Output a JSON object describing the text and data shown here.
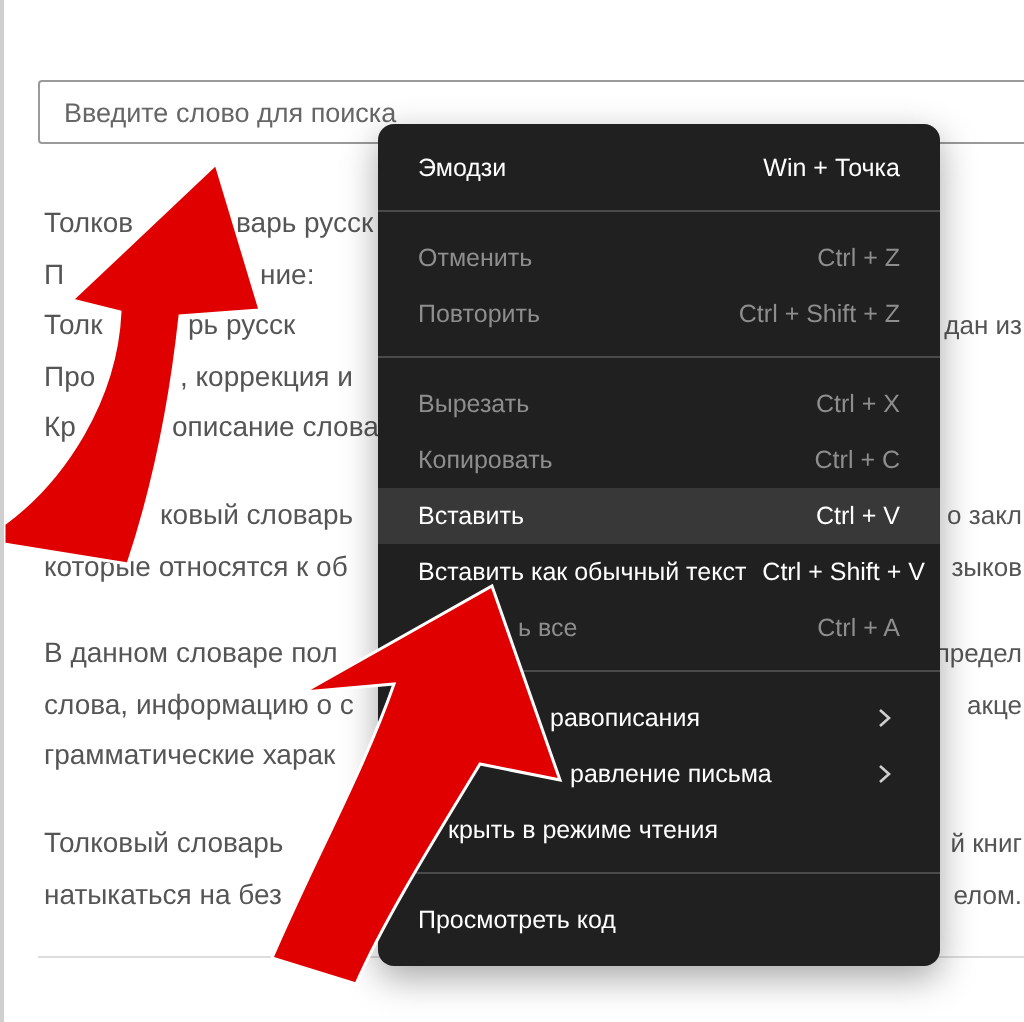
{
  "search": {
    "placeholder": "Введите слово для поиска"
  },
  "paragraphs": [
    {
      "lines": [
        {
          "parts": [
            "Толков",
            "варь русск"
          ]
        },
        {
          "parts": [
            "П",
            "ние:"
          ]
        },
        {
          "parts": [
            "Толк",
            "рь русск"
          ],
          "right": "дан из"
        },
        {
          "parts": [
            "Про",
            ", коррекция и"
          ]
        },
        {
          "parts": [
            "Кр",
            "описание слова"
          ]
        }
      ]
    },
    {
      "lines": [
        {
          "parts": [
            "ковый словарь"
          ],
          "right": "о закл"
        },
        {
          "parts": [
            "которые относятся к об"
          ],
          "right": "зыков"
        }
      ]
    },
    {
      "lines": [
        {
          "parts": [
            "В данном словаре пол"
          ],
          "right": "предел"
        },
        {
          "parts": [
            "слова, информацию о с"
          ],
          "right": "акце"
        },
        {
          "parts": [
            "грамматические харак"
          ]
        }
      ]
    },
    {
      "lines": [
        {
          "parts": [
            "Толковый словарь"
          ],
          "right": "й книг"
        },
        {
          "parts": [
            "натыкаться на без"
          ],
          "right": "елом."
        }
      ]
    }
  ],
  "context_menu": {
    "items": [
      {
        "kind": "item",
        "label": "Эмодзи",
        "shortcut": "Win + Точка",
        "disabled": false,
        "selected": false
      },
      {
        "kind": "divider"
      },
      {
        "kind": "item",
        "label": "Отменить",
        "shortcut": "Ctrl + Z",
        "disabled": true,
        "selected": false
      },
      {
        "kind": "item",
        "label": "Повторить",
        "shortcut": "Ctrl + Shift + Z",
        "disabled": true,
        "selected": false
      },
      {
        "kind": "divider"
      },
      {
        "kind": "item",
        "label": "Вырезать",
        "shortcut": "Ctrl + X",
        "disabled": true,
        "selected": false
      },
      {
        "kind": "item",
        "label": "Копировать",
        "shortcut": "Ctrl + C",
        "disabled": true,
        "selected": false
      },
      {
        "kind": "item",
        "label": "Вставить",
        "shortcut": "Ctrl + V",
        "disabled": false,
        "selected": true
      },
      {
        "kind": "item",
        "label": "Вставить как обычный текст",
        "shortcut": "Ctrl + Shift + V",
        "disabled": false,
        "selected": false
      },
      {
        "kind": "item",
        "label": "ь все",
        "shortcut": "Ctrl + A",
        "disabled": true,
        "selected": false
      },
      {
        "kind": "divider"
      },
      {
        "kind": "submenu",
        "label": "равописания",
        "disabled": false,
        "selected": false
      },
      {
        "kind": "submenu",
        "label": "равление письма",
        "disabled": false,
        "selected": false
      },
      {
        "kind": "item",
        "label": "крыть в режиме чтения",
        "disabled": false,
        "selected": false
      },
      {
        "kind": "divider"
      },
      {
        "kind": "item",
        "label": "Просмотреть код",
        "disabled": false,
        "selected": false
      }
    ]
  }
}
